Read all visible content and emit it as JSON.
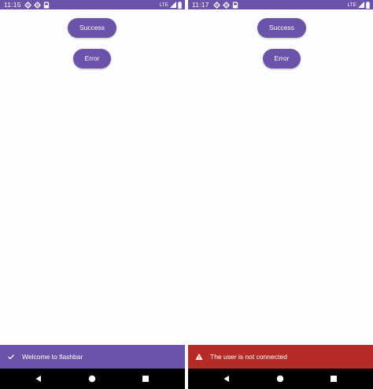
{
  "screens": [
    {
      "status_bar": {
        "time": "11:15",
        "network": "LTE"
      },
      "buttons": {
        "success_label": "Success",
        "error_label": "Error"
      },
      "flashbar": {
        "type": "success",
        "icon": "check-icon",
        "message": "Welcome to flashbar"
      }
    },
    {
      "status_bar": {
        "time": "11:17",
        "network": "LTE"
      },
      "buttons": {
        "success_label": "Success",
        "error_label": "Error"
      },
      "flashbar": {
        "type": "error",
        "icon": "warning-icon",
        "message": "The user is not connected"
      }
    }
  ],
  "colors": {
    "primary": "#6a53a8",
    "error": "#b62b25",
    "background": "#fdfcfe",
    "nav_bar": "#000000"
  }
}
